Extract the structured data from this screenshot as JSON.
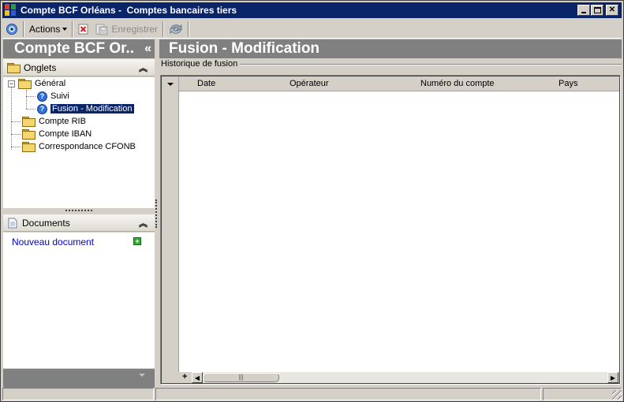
{
  "window": {
    "title": "Compte BCF Orléans -  Comptes bancaires tiers",
    "controls": [
      "minimize",
      "maximize",
      "close"
    ]
  },
  "toolbar": {
    "actions_label": "Actions",
    "save_label": "Enregistrer",
    "save_enabled": false
  },
  "left_panel": {
    "header": "Compte BCF Or..",
    "collapse_glyph": "«",
    "tabs_section": "Onglets",
    "tree": {
      "general": "Général",
      "suivi": "Suivi",
      "fusion": "Fusion - Modification",
      "compte_rib": "Compte RIB",
      "compte_iban": "Compte IBAN",
      "correspondance": "Correspondance CFONB"
    },
    "documents_section": "Documents",
    "new_document": "Nouveau document"
  },
  "main": {
    "header": "Fusion - Modification",
    "group_label": "Historique de fusion",
    "columns": [
      "Date",
      "Opérateur",
      "Numéro du compte",
      "Pays"
    ],
    "rows": []
  },
  "colors": {
    "titlebar": "#0a246a",
    "header_bg": "#808080",
    "link": "#0000cc"
  },
  "icons": [
    "app-icon",
    "refresh-circle-icon",
    "delete-icon",
    "save-icon",
    "sync-icon",
    "folder-icon",
    "help-icon",
    "document-icon",
    "add-icon"
  ]
}
